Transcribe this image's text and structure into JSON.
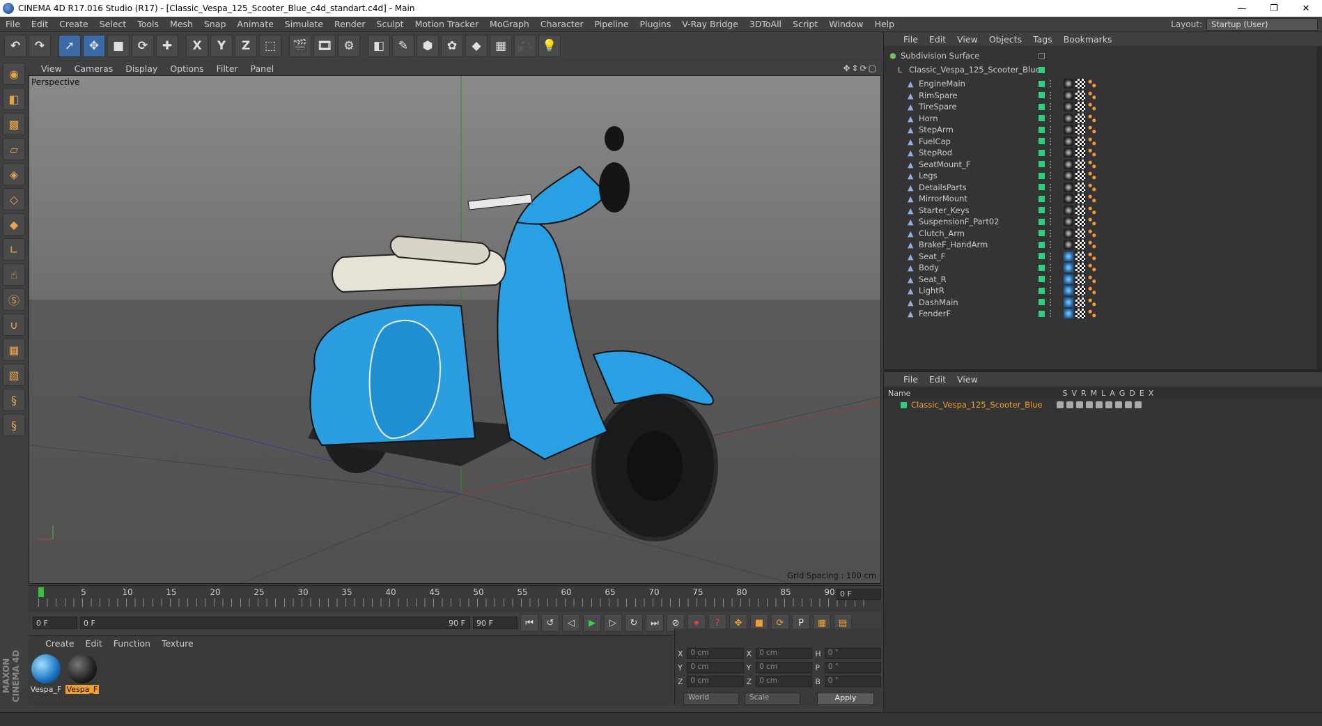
{
  "window": {
    "title": "CINEMA 4D R17.016 Studio (R17) - [Classic_Vespa_125_Scooter_Blue_c4d_standart.c4d] - Main"
  },
  "menubar": {
    "items": [
      "File",
      "Edit",
      "Create",
      "Select",
      "Tools",
      "Mesh",
      "Snap",
      "Animate",
      "Simulate",
      "Render",
      "Sculpt",
      "Motion Tracker",
      "MoGraph",
      "Character",
      "Pipeline",
      "Plugins",
      "V-Ray Bridge",
      "3DToAll",
      "Script",
      "Window",
      "Help"
    ],
    "layout_label": "Layout:",
    "layout_value": "Startup (User)"
  },
  "viewport": {
    "menu": [
      "View",
      "Cameras",
      "Display",
      "Options",
      "Filter",
      "Panel"
    ],
    "label": "Perspective",
    "grid_spacing": "Grid Spacing : 100 cm"
  },
  "timeline": {
    "ticks": [
      "0",
      "5",
      "10",
      "15",
      "20",
      "25",
      "30",
      "35",
      "40",
      "45",
      "50",
      "55",
      "60",
      "65",
      "70",
      "75",
      "80",
      "85",
      "90"
    ],
    "end_field": "0 F"
  },
  "playbar": {
    "start": "0 F",
    "range_start": "0 F",
    "range_end": "90 F",
    "end": "90 F"
  },
  "materials": {
    "menu": [
      "Create",
      "Edit",
      "Function",
      "Texture"
    ],
    "items": [
      {
        "label": "Vespa_F"
      },
      {
        "label": "Vespa_F"
      }
    ]
  },
  "coords": {
    "rows": [
      {
        "a": "X",
        "av": "0 cm",
        "b": "X",
        "bv": "0 cm",
        "c": "H",
        "cv": "0 °"
      },
      {
        "a": "Y",
        "av": "0 cm",
        "b": "Y",
        "bv": "0 cm",
        "c": "P",
        "cv": "0 °"
      },
      {
        "a": "Z",
        "av": "0 cm",
        "b": "Z",
        "bv": "0 cm",
        "c": "B",
        "cv": "0 °"
      }
    ],
    "world": "World",
    "scale": "Scale",
    "apply": "Apply"
  },
  "objects": {
    "menu": [
      "File",
      "Edit",
      "View",
      "Objects",
      "Tags",
      "Bookmarks"
    ],
    "root": "Subdivision Surface",
    "group": "Classic_Vespa_125_Scooter_Blue",
    "children": [
      "EngineMain",
      "RimSpare",
      "TireSpare",
      "Horn",
      "StepArm",
      "FuelCap",
      "StepRod",
      "SeatMount_F",
      "Legs",
      "DetailsParts",
      "MirrorMount",
      "Starter_Keys",
      "SuspensionF_Part02",
      "Clutch_Arm",
      "BrakeF_HandArm",
      "Seat_F",
      "Body",
      "Seat_R",
      "LightR",
      "DashMain",
      "FenderF"
    ]
  },
  "attributes": {
    "menu": [
      "File",
      "Edit",
      "View"
    ],
    "name_header": "Name",
    "columns": [
      "S",
      "V",
      "R",
      "M",
      "L",
      "A",
      "G",
      "D",
      "E",
      "X"
    ],
    "layer": "Classic_Vespa_125_Scooter_Blue"
  },
  "brand": "MAXON CINEMA 4D"
}
